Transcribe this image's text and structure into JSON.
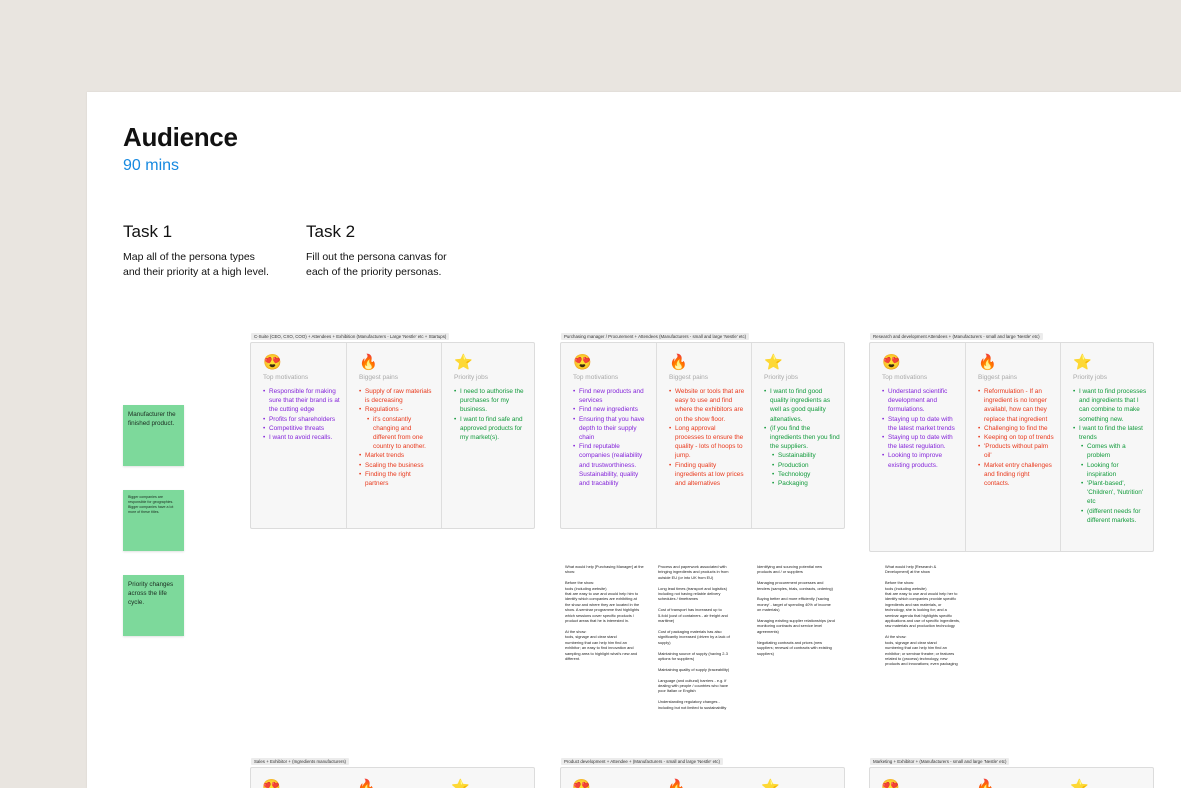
{
  "header": {
    "title": "Audience",
    "duration": "90 mins"
  },
  "tasks": [
    {
      "title": "Task 1",
      "desc": "Map all of the persona types\nand their priority at a high level."
    },
    {
      "title": "Task 2",
      "desc": "Fill out the persona canvas for\neach of the priority personas."
    }
  ],
  "stickies": [
    "Manufacturer the finished product.",
    "Bigger companies are responsible for geographies. Bigger companies have a lot more of these titles.",
    "Priority changes across the life cycle."
  ],
  "column_heads": {
    "motivations": "Top motivations",
    "pains": "Biggest pains",
    "jobs": "Priority jobs"
  },
  "icons": {
    "motivations": "heart-eyes-emoji-icon",
    "pains": "fire-emoji-icon",
    "jobs": "star-emoji-icon"
  },
  "colors": {
    "motivations": "#8424d9",
    "pains": "#e8391c",
    "jobs": "#119a3b",
    "sticky": "#7dd99b",
    "accent": "#1689e0"
  },
  "personas": [
    {
      "label": "C-Suite (CEO, CXO, COO) + Attendees + Exhibition (Manufacturers - Large 'Nestle' etc + Startups)",
      "motivations": [
        {
          "t": "Responsible for making sure that their brand is at the cutting edge"
        },
        {
          "t": "Profits for shareholders"
        },
        {
          "t": "Competitive threats"
        },
        {
          "t": "I want to avoid recalls."
        }
      ],
      "pains": [
        {
          "t": "Supply of raw materials is decreasing"
        },
        {
          "t": "Regulations -"
        },
        {
          "t": "it's constantly changing and different from one country to another.",
          "sub": true
        },
        {
          "t": "Market trends"
        },
        {
          "t": "Scaling the business"
        },
        {
          "t": "Finding the right partners"
        }
      ],
      "jobs": [
        {
          "t": "I need to authorise the purchases for my business."
        },
        {
          "t": "I want to find safe and approved products for my market(s)."
        }
      ]
    },
    {
      "label": "Purchasing manager / Procurement + Attendees (Manufacturers - small and large 'Nestle' etc)",
      "motivations": [
        {
          "t": "Find new products and services"
        },
        {
          "t": "Find new ingredients"
        },
        {
          "t": "Ensuring that you have depth to their supply chain"
        },
        {
          "t": "Find reputable companies (realiability and trustworthiness. Sustainability, quality and tracability"
        }
      ],
      "pains": [
        {
          "t": "Website or tools that are easy to use and find where the exhibitors are on the show floor."
        },
        {
          "t": "Long approval processes to ensure the quality - lots of hoops to jump."
        },
        {
          "t": "Finding quality ingredients at low prices and alternatives"
        }
      ],
      "jobs": [
        {
          "t": "I want to find good quality ingredients as well as good quality altenatives."
        },
        {
          "t": "(if you find the ingredients then you find the suppliers."
        },
        {
          "t": "Sustainability",
          "sub": true
        },
        {
          "t": "Production",
          "sub": true
        },
        {
          "t": "Technology",
          "sub": true
        },
        {
          "t": "Packaging",
          "sub": true
        }
      ]
    },
    {
      "label": "Research and development Attendees + (Manufacturers - small and large 'Nestle' etc)",
      "motivations": [
        {
          "t": "Understand scientific development and formulations."
        },
        {
          "t": "Staying up to date with the latest market trends"
        },
        {
          "t": "Staying up to date with the latest regulation."
        },
        {
          "t": "Looking to improve existing products."
        }
      ],
      "pains": [
        {
          "t": "Reformulation - If an ingredient is no longer availabl, how can they replace that ingredient"
        },
        {
          "t": "Challenging to find the"
        },
        {
          "t": "Keeping on top of trends"
        },
        {
          "t": "'Products without palm oil'"
        },
        {
          "t": "Market entry challenges and finding right contacts."
        }
      ],
      "jobs": [
        {
          "t": "I want to find processes and ingredients that I can combine to make something new."
        },
        {
          "t": "I want to find the latest trends"
        },
        {
          "t": "Comes with a problem",
          "sub": true
        },
        {
          "t": "Looking for inspiration",
          "sub": true
        },
        {
          "t": "'Plant-based', 'Children', 'Nutrition' etc",
          "sub": true
        },
        {
          "t": "(different needs for different markets.",
          "sub": true
        }
      ]
    }
  ],
  "notes": [
    "What would help [Purchasing Manager] at the show:\n\nBefore the show:\ntools (including website)\nthat are easy to use and would help him to\nidentify which companies are exhibiting at\nthe show and where they are located in the\nshow. A seminar programme that highlights\nwhich sessions cover specific products /\nproduct areas that he is interested in.\n\nAt the show:\ntools, signage and clear stand\nnumbering that can help him find an\nexhibitor; an easy to find innovation and\nsampling area to highlight what's new and\ndifferent.",
    "Process and paperwork associated with\nbringing ingredients and products in from\noutside EU (or into UK from EU)\n\nLong lead times (transport and logistics)\nincluding not having reliable delivery\nschedules / timeframes\n\nCost of transport has increased up to\n5-fold (cost of containers - air freight and\nmaritime)\n\nCost of packaging materials has also\nsignificantly increased (driven by a lack of\nsupply)\n\nMaintaining source of supply (having 2-3\noptions for suppliers)\n\nMaintaining quality of supply (traceability)\n\nLanguage (and cultural) barriers - e.g. if\ndealing with people / countries who have\npoor Italian or English\n\nUnderstanding regulatory changes -\nincluding but not limited to sustainability",
    "Identifying and sourcing potential new\nproducts and / or suppliers\n\nManaging procurement processes and\ntenders (samples, trials, contracts, ordering)\n\nBuying better and more efficiently ('saving\nmoney' - target of spending 40% of income\non materials)\n\nManaging existing supplier relationships (and\nmonitoring contracts and service level\nagreements)\n\nNegotiating contracts and prices (new\nsuppliers; renewal of contracts with existing\nsuppliers)",
    "What would help [Research &\nDevelopment] at the show\n\nBefore the show:\ntools (including website)\nthat are easy to use and would help her to\nidentify which companies provide specific\ningredients and raw materials, or\ntechnology, she is looking for; and a\nseminar agenda that highlights specific\napplications and use of specific ingredients,\nraw materials and production technology\n\nAt the show:\ntools, signage and clear stand\nnumbering that can help him find an\nexhibitor; or seminar theatre; or features\nrelated to (process) technology, new\nproducts and innovations; even packaging"
  ],
  "bottom_labels": [
    "Sales + Exhibitor + (Ingredients manufacturers)",
    "Product development + Attendee + (Manufacturers - small and large 'Nestle' etc)",
    "Marketing + Exhibitor + (Manufacturers - small and large 'Nestle' etc)"
  ]
}
